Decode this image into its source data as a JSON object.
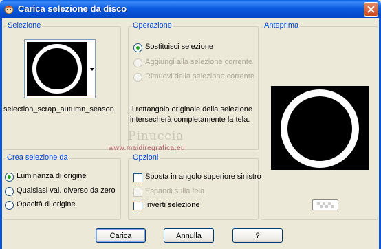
{
  "window": {
    "title": "Carica selezione da disco"
  },
  "selezione": {
    "legend": "Selezione",
    "filename": "selection_scrap_autumn_season"
  },
  "operazione": {
    "legend": "Operazione",
    "options": [
      {
        "label": "Sostituisci selezione",
        "checked": true,
        "enabled": true
      },
      {
        "label": "Aggiungi alla selezione corrente",
        "checked": false,
        "enabled": false
      },
      {
        "label": "Rimuovi dalla selezione corrente",
        "checked": false,
        "enabled": false
      }
    ],
    "info_line1": "Il rettangolo originale della selezione",
    "info_line2": "intersecherà completamente la tela."
  },
  "anteprima": {
    "legend": "Anteprima"
  },
  "crea": {
    "legend": "Crea selezione da",
    "options": [
      {
        "label": "Luminanza di origine",
        "checked": true
      },
      {
        "label": "Qualsiasi val. diverso da zero",
        "checked": false
      },
      {
        "label": "Opacità di origine",
        "checked": false
      }
    ]
  },
  "opzioni": {
    "legend": "Opzioni",
    "options": [
      {
        "label": "Sposta in angolo superiore sinistro",
        "checked": false,
        "enabled": true
      },
      {
        "label": "Espandi sulla tela",
        "checked": false,
        "enabled": false
      },
      {
        "label": "Inverti selezione",
        "checked": false,
        "enabled": true
      }
    ]
  },
  "buttons": {
    "ok": "Carica",
    "cancel": "Annulla",
    "help": "?"
  },
  "watermark": {
    "name": "Pinuccia",
    "site": "www.maidiregrafica.eu"
  },
  "colors": {
    "titlebar": "#0b5ce0",
    "legend": "#0046d5",
    "radio_dot": "#21a121"
  }
}
